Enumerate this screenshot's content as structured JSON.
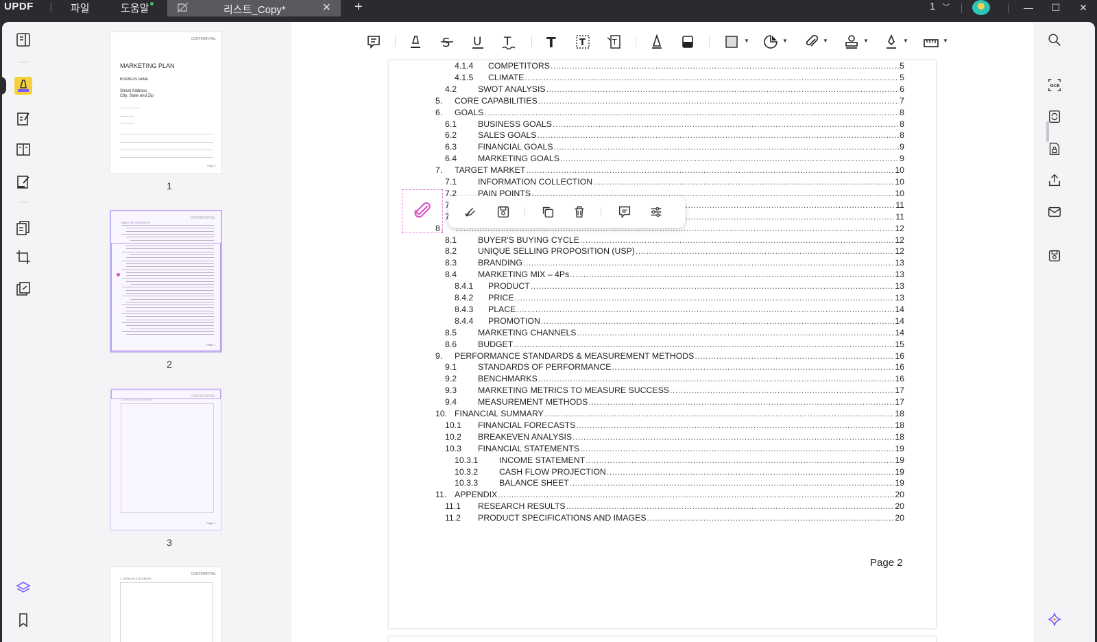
{
  "app": {
    "logo": "UPDF",
    "menu": [
      "파일",
      "도움말"
    ],
    "tab_title": "리스트_Copy*",
    "tab_close": "✕",
    "add_tab": "+",
    "page_indicator": "1",
    "window_controls": [
      "—",
      "☐",
      "✕"
    ]
  },
  "thumbnails": [
    {
      "num": "1",
      "title": "MARKETING PLAN",
      "sub": "BUSINESS NAME",
      "addr1": "Street Address",
      "addr2": "City, State and Zip",
      "conf": "CONFIDENTIAL",
      "pg": "Page 1"
    },
    {
      "num": "2",
      "title": "TABLE OF CONTENTS",
      "conf": "CONFIDENTIAL",
      "pg": "Page 2"
    },
    {
      "num": "3",
      "title": "1. MISSION STATEMENT",
      "conf": "CONFIDENTIAL",
      "pg": "Page 3"
    },
    {
      "num": "",
      "title": "2. MISSION STATEMENT",
      "conf": "CONFIDENTIAL"
    }
  ],
  "toc": [
    {
      "num": "4.1.4",
      "title": "COMPETITORS",
      "page": "5",
      "level": 3
    },
    {
      "num": "4.1.5",
      "title": "CLIMATE",
      "page": "5",
      "level": 3
    },
    {
      "num": "4.2",
      "title": "SWOT ANALYSIS",
      "page": "6",
      "level": 2
    },
    {
      "num": "5.",
      "title": "CORE CAPABILITIES",
      "page": "7",
      "level": 1
    },
    {
      "num": "6.",
      "title": "GOALS",
      "page": "8",
      "level": 1
    },
    {
      "num": "6.1",
      "title": "BUSINESS GOALS",
      "page": "8",
      "level": 2
    },
    {
      "num": "6.2",
      "title": "SALES GOALS",
      "page": "8",
      "level": 2
    },
    {
      "num": "6.3",
      "title": "FINANCIAL GOALS",
      "page": "9",
      "level": 2
    },
    {
      "num": "6.4",
      "title": "MARKETING GOALS",
      "page": "9",
      "level": 2
    },
    {
      "num": "7.",
      "title": "TARGET MARKET",
      "page": "10",
      "level": 1
    },
    {
      "num": "7.1",
      "title": "INFORMATION COLLECTION",
      "page": "10",
      "level": 2
    },
    {
      "num": "7.2",
      "title": "PAIN POINTS",
      "page": "10",
      "level": 2
    },
    {
      "num": "7",
      "title": "",
      "page": "11",
      "level": 2
    },
    {
      "num": "7",
      "title": "",
      "page": "11",
      "level": 2
    },
    {
      "num": "8.",
      "title": "",
      "page": "12",
      "level": 1
    },
    {
      "num": "8.1",
      "title": "BUYER'S BUYING CYCLE",
      "page": "12",
      "level": 2
    },
    {
      "num": "8.2",
      "title": "UNIQUE SELLING PROPOSITION (USP)",
      "page": "12",
      "level": 2
    },
    {
      "num": "8.3",
      "title": "BRANDING",
      "page": "13",
      "level": 2
    },
    {
      "num": "8.4",
      "title": "MARKETING MIX – 4Ps",
      "page": "13",
      "level": 2
    },
    {
      "num": "8.4.1",
      "title": "PRODUCT",
      "page": "13",
      "level": 3
    },
    {
      "num": "8.4.2",
      "title": "PRICE",
      "page": "13",
      "level": 3
    },
    {
      "num": "8.4.3",
      "title": "PLACE",
      "page": "14",
      "level": 3
    },
    {
      "num": "8.4.4",
      "title": "PROMOTION",
      "page": "14",
      "level": 3
    },
    {
      "num": "8.5",
      "title": "MARKETING CHANNELS",
      "page": "14",
      "level": 2
    },
    {
      "num": "8.6",
      "title": "BUDGET",
      "page": "15",
      "level": 2
    },
    {
      "num": "9.",
      "title": "PERFORMANCE STANDARDS & MEASUREMENT METHODS",
      "page": "16",
      "level": 1
    },
    {
      "num": "9.1",
      "title": "STANDARDS OF PERFORMANCE",
      "page": "16",
      "level": 2
    },
    {
      "num": "9.2",
      "title": "BENCHMARKS",
      "page": "16",
      "level": 2
    },
    {
      "num": "9.3",
      "title": "MARKETING METRICS TO MEASURE SUCCESS",
      "page": "17",
      "level": 2
    },
    {
      "num": "9.4",
      "title": "MEASUREMENT METHODS",
      "page": "17",
      "level": 2
    },
    {
      "num": "10.",
      "title": "FINANCIAL SUMMARY",
      "page": "18",
      "level": 1
    },
    {
      "num": "10.1",
      "title": "FINANCIAL FORECASTS",
      "page": "18",
      "level": 2
    },
    {
      "num": "10.2",
      "title": "BREAKEVEN ANALYSIS",
      "page": "18",
      "level": 2
    },
    {
      "num": "10.3",
      "title": "FINANCIAL STATEMENTS",
      "page": "19",
      "level": 2
    },
    {
      "num": "10.3.1",
      "title": "INCOME STATEMENT",
      "page": "19",
      "level": 3
    },
    {
      "num": "10.3.2",
      "title": "CASH FLOW PROJECTION",
      "page": "19",
      "level": 3
    },
    {
      "num": "10.3.3",
      "title": "BALANCE SHEET",
      "page": "19",
      "level": 3
    },
    {
      "num": "11.",
      "title": "APPENDIX",
      "page": "20",
      "level": 1
    },
    {
      "num": "11.1",
      "title": "RESEARCH RESULTS",
      "page": "20",
      "level": 2
    },
    {
      "num": "11.2",
      "title": "PRODUCT SPECIFICATIONS AND IMAGES",
      "page": "20",
      "level": 2
    }
  ],
  "page_footer": "Page 2",
  "colors": {
    "accent_highlight": "#f6d13c",
    "attachment_pink": "#d94fc8",
    "selection_purple": "#c7b0f2"
  }
}
